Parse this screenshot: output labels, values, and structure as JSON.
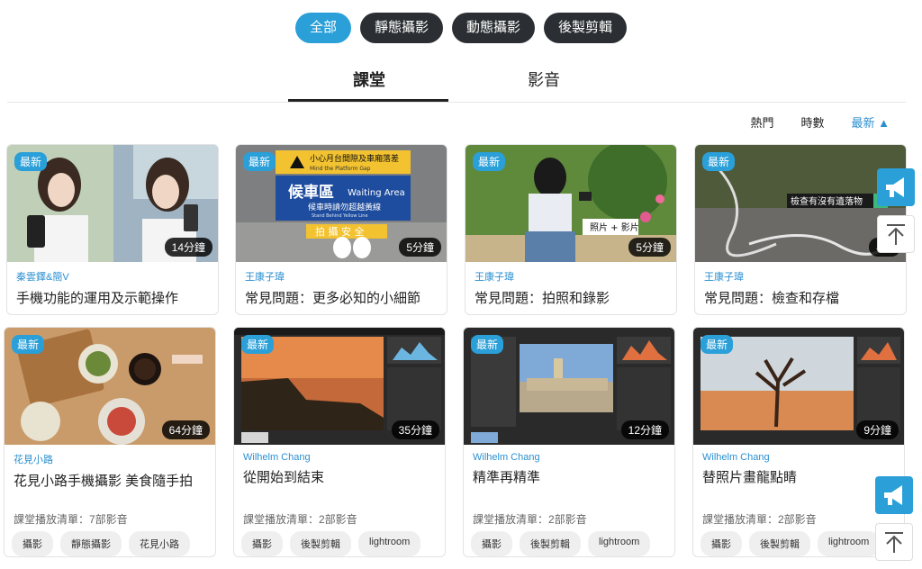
{
  "filters": [
    "全部",
    "靜態攝影",
    "動態攝影",
    "後製剪輯"
  ],
  "tabs": {
    "class_label": "課堂",
    "video_label": "影音"
  },
  "sort": {
    "hot": "熱門",
    "length": "時數",
    "newest": "最新 ▲"
  },
  "row1": [
    {
      "badge": "最新",
      "duration": "14分鐘",
      "author": "秦雲鐸&簡V",
      "title": "手機功能的運用及示範操作"
    },
    {
      "badge": "最新",
      "duration": "5分鐘",
      "author": "王康子瑋",
      "title": "常見問題：更多必知的小細節",
      "thumb_text": {
        "sign_top": "小心月台間隙及車廂落差",
        "sign_sub": "Mind the Platform Gap",
        "big": "候車區",
        "big_en": "Waiting Area",
        "line": "候車時請勿超越黃線",
        "line_en": "Stand Behind Yellow Line",
        "floor": "拍 攝 安 全"
      }
    },
    {
      "badge": "最新",
      "duration": "5分鐘",
      "author": "王康子瑋",
      "title": "常見問題：拍照和錄影",
      "thumb_text": {
        "label": "照片 + 影片"
      }
    },
    {
      "badge": "最新",
      "duration": "4分",
      "author": "王康子瑋",
      "title": "常見問題：檢查和存檔",
      "thumb_text": {
        "label": "檢查有沒有遺落物"
      }
    }
  ],
  "row2": [
    {
      "badge": "最新",
      "duration": "64分鐘",
      "author": "花見小路",
      "title": "花見小路手機攝影 美食隨手拍",
      "playlist": "課堂播放清單：7部影音",
      "tags": [
        "攝影",
        "靜態攝影",
        "花見小路"
      ]
    },
    {
      "badge": "最新",
      "duration": "35分鐘",
      "author": "Wilhelm Chang",
      "title": "從開始到結束",
      "playlist": "課堂播放清單：2部影音",
      "tags": [
        "攝影",
        "後製剪輯",
        "lightroom"
      ]
    },
    {
      "badge": "最新",
      "duration": "12分鐘",
      "author": "Wilhelm Chang",
      "title": "精準再精準",
      "playlist": "課堂播放清單：2部影音",
      "tags": [
        "攝影",
        "後製剪輯",
        "lightroom"
      ]
    },
    {
      "badge": "最新",
      "duration": "9分鐘",
      "author": "Wilhelm Chang",
      "title": "替照片畫龍點睛",
      "playlist": "課堂播放清單：2部影音",
      "tags": [
        "攝影",
        "後製剪輯",
        "lightroom"
      ]
    }
  ],
  "colors": {
    "accent": "#2a9fd8",
    "dark_pill": "#2b2f33"
  }
}
